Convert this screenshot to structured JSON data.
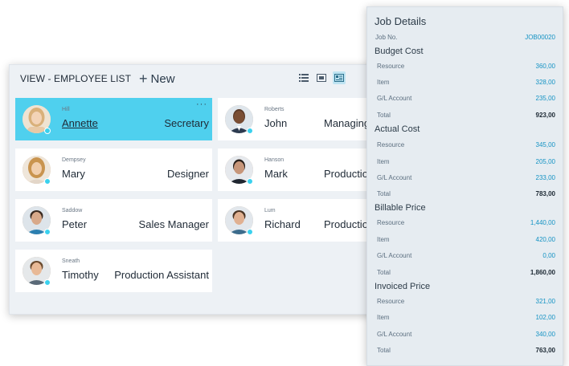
{
  "list": {
    "title": "VIEW - EMPLOYEE LIST",
    "new_label": "New",
    "view_icons": [
      "list-view-icon",
      "tile-view-icon",
      "card-view-icon"
    ],
    "accent_color": "#4fd0ee",
    "employees": [
      {
        "surname": "Hill",
        "first_name": "Annette",
        "role": "Secretary",
        "selected": true
      },
      {
        "surname": "Roberts",
        "first_name": "John",
        "role": "Managing",
        "selected": false
      },
      {
        "surname": "Dempsey",
        "first_name": "Mary",
        "role": "Designer",
        "selected": false
      },
      {
        "surname": "Hanson",
        "first_name": "Mark",
        "role": "Production",
        "selected": false
      },
      {
        "surname": "Saddow",
        "first_name": "Peter",
        "role": "Sales Manager",
        "selected": false
      },
      {
        "surname": "Lum",
        "first_name": "Richard",
        "role": "Production",
        "selected": false
      },
      {
        "surname": "Sneath",
        "first_name": "Timothy",
        "role": "Production Assistant",
        "selected": false
      }
    ]
  },
  "job": {
    "title": "Job Details",
    "job_no_label": "Job No.",
    "job_no": "JOB00020",
    "budget": {
      "heading": "Budget Cost",
      "rows": [
        {
          "label": "Resource",
          "value": "360,00"
        },
        {
          "label": "Item",
          "value": "328,00"
        },
        {
          "label": "G/L Account",
          "value": "235,00"
        },
        {
          "label": "Total",
          "value": "923,00"
        }
      ]
    },
    "actual": {
      "heading": "Actual Cost",
      "rows": [
        {
          "label": "Resource",
          "value": "345,00"
        },
        {
          "label": "Item",
          "value": "205,00"
        },
        {
          "label": "G/L Account",
          "value": "233,00"
        },
        {
          "label": "Total",
          "value": "783,00"
        }
      ]
    },
    "billable": {
      "heading": "Billable Price",
      "rows": [
        {
          "label": "Resource",
          "value": "1,440,00"
        },
        {
          "label": "Item",
          "value": "420,00"
        },
        {
          "label": "G/L Account",
          "value": "0,00"
        },
        {
          "label": "Total",
          "value": "1,860,00"
        }
      ]
    },
    "invoiced": {
      "heading": "Invoiced Price",
      "rows": [
        {
          "label": "Resource",
          "value": "321,00"
        },
        {
          "label": "Item",
          "value": "102,00"
        },
        {
          "label": "G/L Account",
          "value": "340,00"
        },
        {
          "label": "Total",
          "value": "763,00"
        }
      ]
    }
  }
}
